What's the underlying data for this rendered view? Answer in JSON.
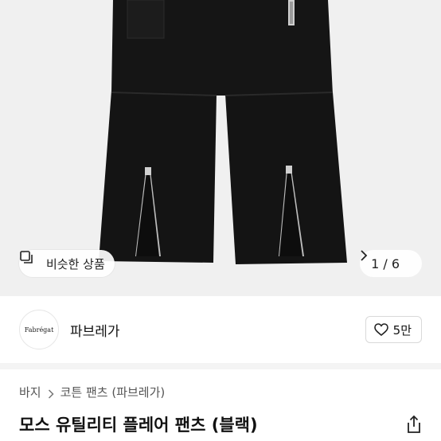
{
  "hero": {
    "similar_label": "비슷한 상품",
    "pager_text": "1 / 6",
    "icons": {
      "similar": "similar-items-icon",
      "next": "chevron-right-icon"
    }
  },
  "shop": {
    "logo_text": "Fabrégat",
    "name": "파브레가",
    "like_count": "5만",
    "icons": {
      "like": "heart-icon"
    }
  },
  "breadcrumb": {
    "items": [
      "바지",
      "코튼 팬츠 (파브레가)"
    ]
  },
  "product": {
    "title": "모스 유틸리티 플레어 팬츠 (블랙)",
    "icons": {
      "share": "share-icon"
    }
  },
  "colors": {
    "background": "#f0f0f0",
    "garment": "#121212",
    "zipper": "#bdbdbd"
  }
}
